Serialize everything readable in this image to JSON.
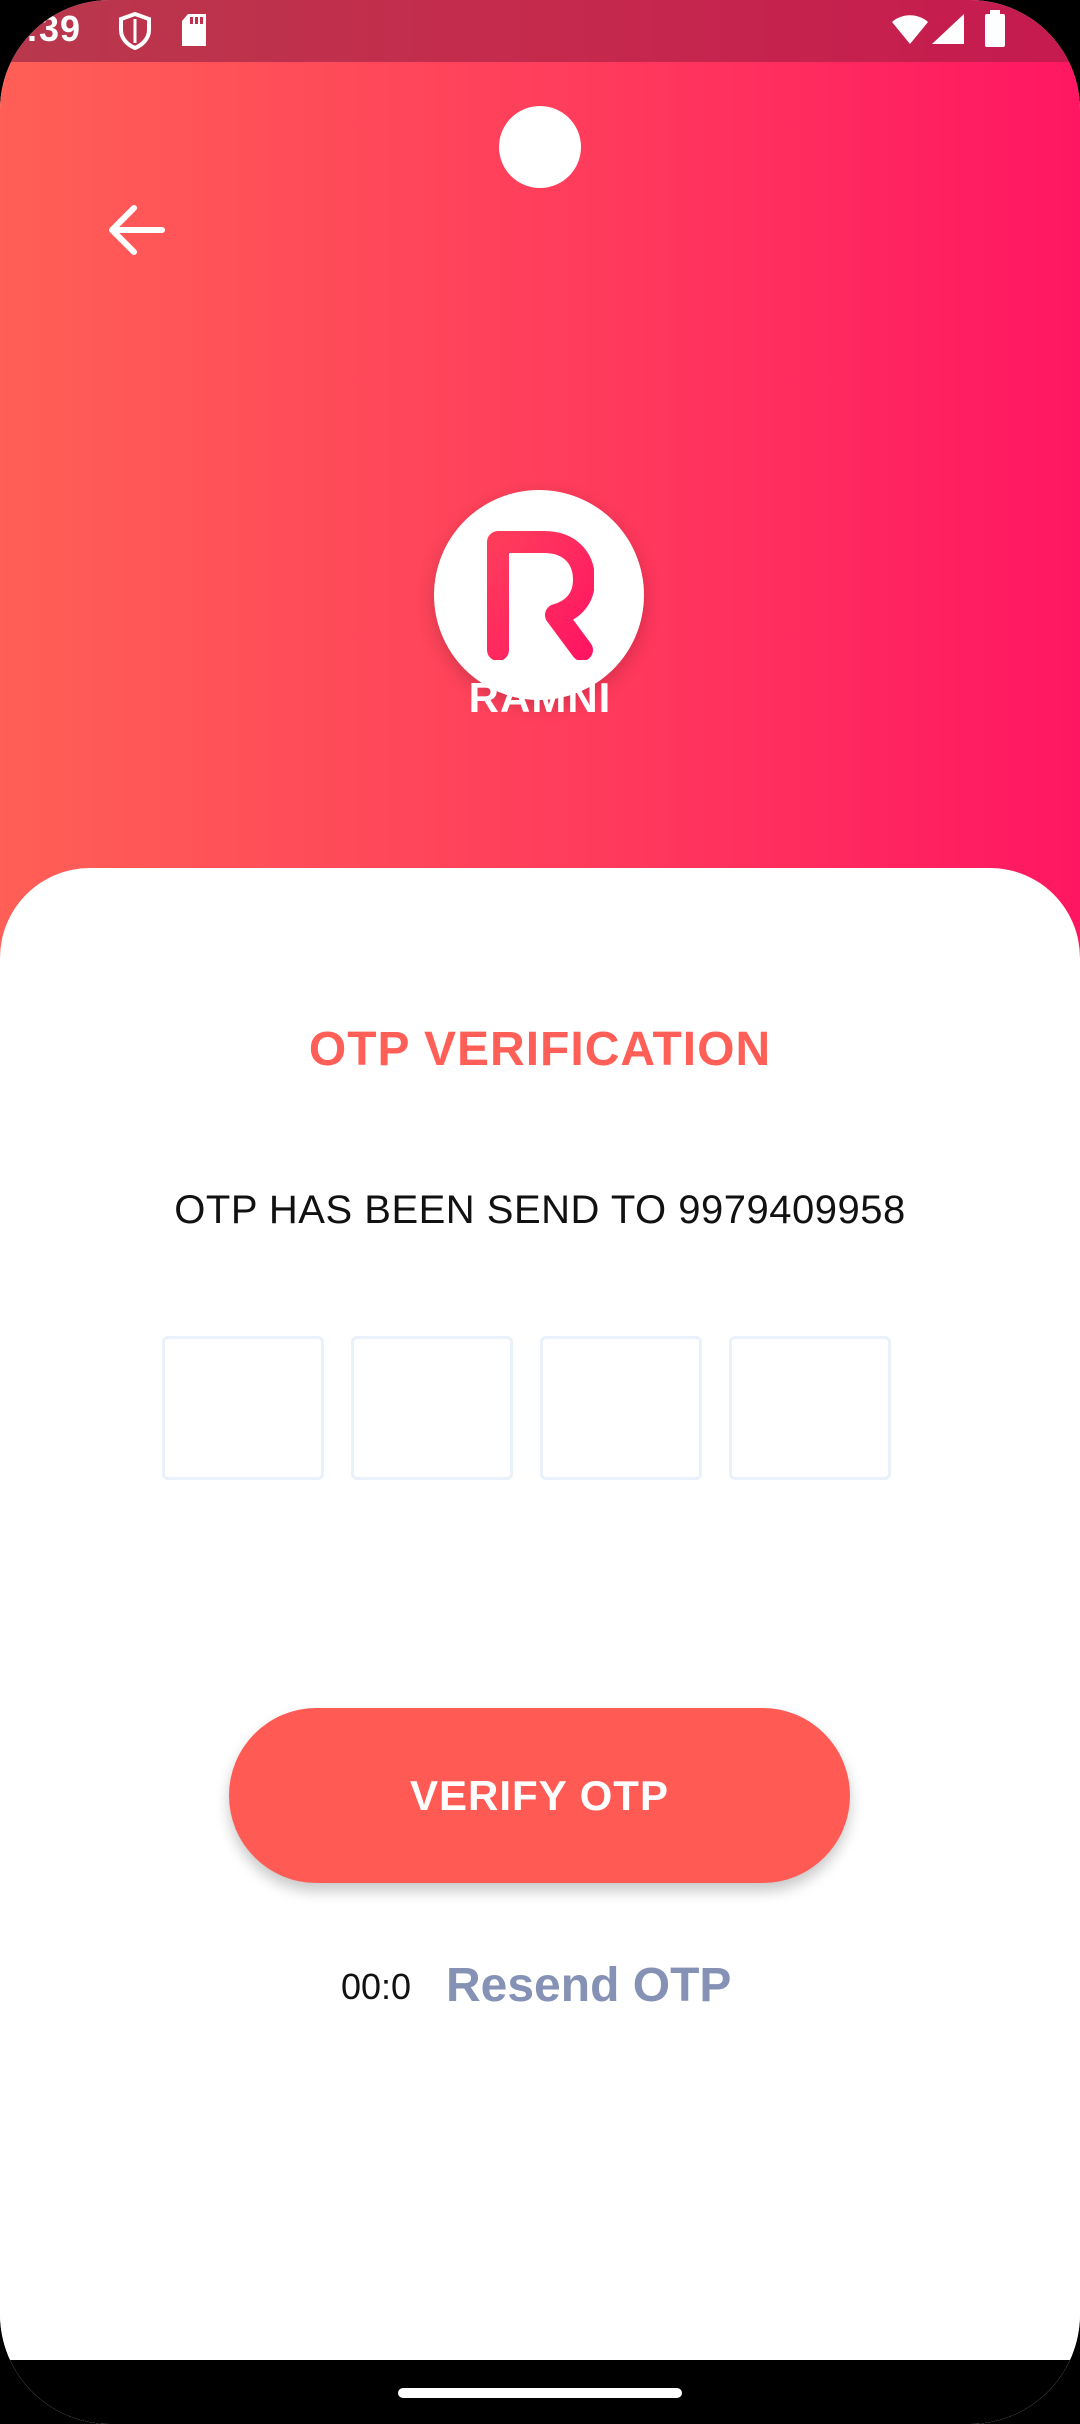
{
  "status_bar": {
    "time": ":39",
    "icons": [
      "shield-icon",
      "sd-card-icon",
      "wifi-icon",
      "signal-icon",
      "battery-icon"
    ]
  },
  "header": {
    "back_icon": "arrow-left-icon",
    "logo_letter": "R",
    "app_name": "RAMNI"
  },
  "otp": {
    "title": "OTP VERIFICATION",
    "description": "OTP HAS BEEN SEND TO 9979409958",
    "boxes": [
      "",
      "",
      "",
      ""
    ],
    "verify_label": "VERIFY OTP",
    "timer": "00:0",
    "resend_label": "Resend OTP"
  },
  "colors": {
    "accent": "#ff5f56",
    "gradient_start": "#ff5f56",
    "gradient_end": "#ff1662",
    "resend": "#8592b5"
  }
}
